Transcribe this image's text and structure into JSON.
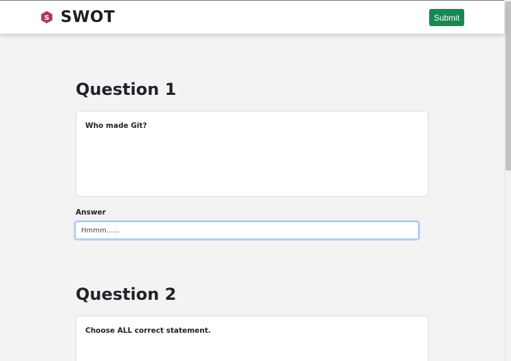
{
  "app": {
    "name": "SWOT",
    "logo_icon": "hexagon-s-logo-icon",
    "logo_color": "#b0396a"
  },
  "header": {
    "submit_label": "Submit",
    "submit_color": "#198754"
  },
  "questions": [
    {
      "title": "Question 1",
      "text": "Who made Git?",
      "answer_label": "Answer",
      "answer_value": "Hmmm......"
    },
    {
      "title": "Question 2",
      "text": "Choose ALL correct statement."
    }
  ]
}
